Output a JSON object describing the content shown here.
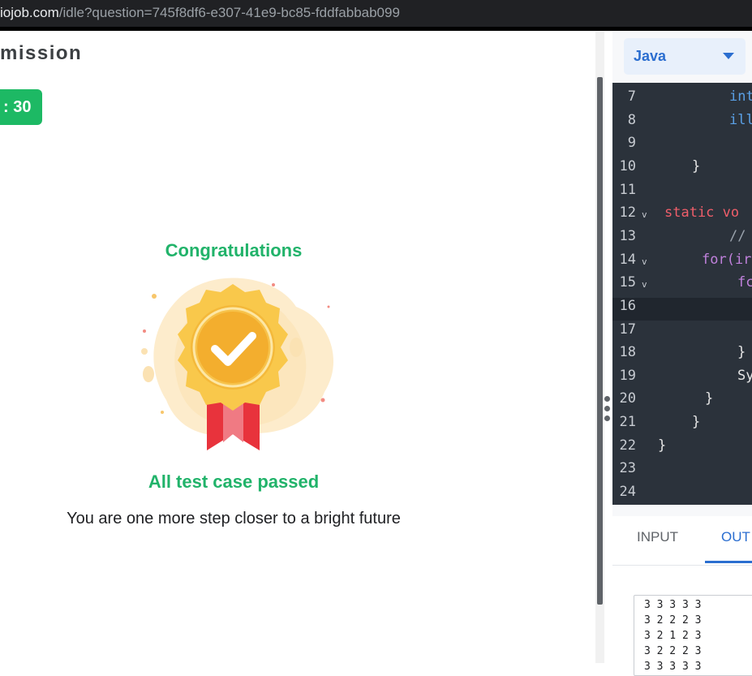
{
  "browser": {
    "url_host": "iojob.com",
    "url_path": "/idle?question=745f8df6-e307-41e9-bc85-fddfabbab099"
  },
  "left": {
    "title": "mission",
    "score": ": 30",
    "congrats": "Congratulations",
    "passed": "All test case passed",
    "tagline": "You are one more step closer to a bright future"
  },
  "right": {
    "language": "Java",
    "tabs": {
      "input": "INPUT",
      "output": "OUT"
    },
    "output_lines": [
      "3 3 3 3 3",
      "3 2 2 2 3",
      "3 2 1 2 3",
      "3 2 2 2 3",
      "3 3 3 3 3"
    ]
  },
  "editor": {
    "active_line": "16",
    "lines": [
      {
        "n": "7",
        "fold": "",
        "code": "int",
        "cls": "k-blue"
      },
      {
        "n": "8",
        "fold": "",
        "code": "ill",
        "cls": "k-blue"
      },
      {
        "n": "9",
        "fold": "",
        "code": "",
        "cls": "k-white"
      },
      {
        "n": "10",
        "fold": "",
        "code": "}",
        "cls": "k-white"
      },
      {
        "n": "11",
        "fold": "",
        "code": "",
        "cls": "k-white"
      },
      {
        "n": "12",
        "fold": "v",
        "code": "static vo",
        "cls": "k-red"
      },
      {
        "n": "13",
        "fold": "",
        "code": "//",
        "cls": "k-gray"
      },
      {
        "n": "14",
        "fold": "v",
        "code": "for(ir",
        "cls": "k-purple"
      },
      {
        "n": "15",
        "fold": "v",
        "code": "fc",
        "cls": "k-purple"
      },
      {
        "n": "16",
        "fold": "",
        "code": "",
        "cls": "k-white"
      },
      {
        "n": "17",
        "fold": "",
        "code": "",
        "cls": "k-white"
      },
      {
        "n": "18",
        "fold": "",
        "code": "}",
        "cls": "k-white"
      },
      {
        "n": "19",
        "fold": "",
        "code": "Sy",
        "cls": "k-white"
      },
      {
        "n": "20",
        "fold": "",
        "code": "}",
        "cls": "k-white"
      },
      {
        "n": "21",
        "fold": "",
        "code": "}",
        "cls": "k-white"
      },
      {
        "n": "22",
        "fold": "",
        "code": "}",
        "cls": "k-white"
      },
      {
        "n": "23",
        "fold": "",
        "code": "",
        "cls": "k-white"
      },
      {
        "n": "24",
        "fold": "",
        "code": "",
        "cls": "k-white"
      }
    ]
  }
}
